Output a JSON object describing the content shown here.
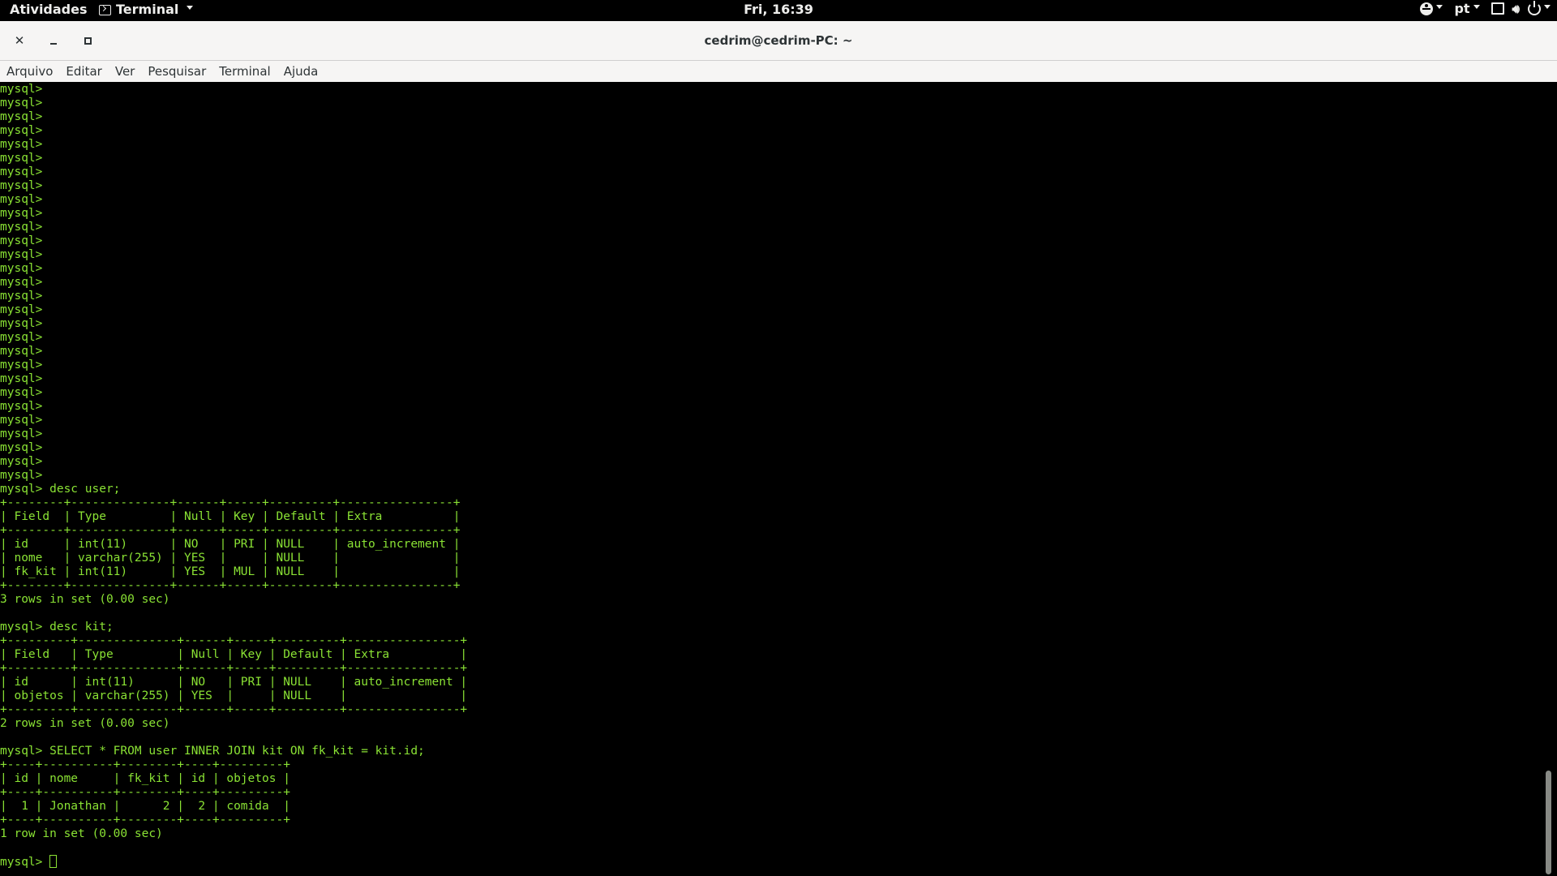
{
  "topbar": {
    "activities": "Atividades",
    "app_menu": "Terminal",
    "clock": "Fri, 16:39",
    "language": "pt"
  },
  "window": {
    "title": "cedrim@cedrim-PC: ~"
  },
  "menu": {
    "items": [
      "Arquivo",
      "Editar",
      "Ver",
      "Pesquisar",
      "Terminal",
      "Ajuda"
    ]
  },
  "terminal": {
    "text_color": "#8ae234",
    "lines": [
      "mysql>",
      "mysql>",
      "mysql>",
      "mysql>",
      "mysql>",
      "mysql>",
      "mysql>",
      "mysql>",
      "mysql>",
      "mysql>",
      "mysql>",
      "mysql>",
      "mysql>",
      "mysql>",
      "mysql>",
      "mysql>",
      "mysql>",
      "mysql>",
      "mysql>",
      "mysql>",
      "mysql>",
      "mysql>",
      "mysql>",
      "mysql>",
      "mysql>",
      "mysql>",
      "mysql>",
      "mysql>",
      "mysql>",
      "mysql> desc user;",
      "+--------+--------------+------+-----+---------+----------------+",
      "| Field  | Type         | Null | Key | Default | Extra          |",
      "+--------+--------------+------+-----+---------+----------------+",
      "| id     | int(11)      | NO   | PRI | NULL    | auto_increment |",
      "| nome   | varchar(255) | YES  |     | NULL    |                |",
      "| fk_kit | int(11)      | YES  | MUL | NULL    |                |",
      "+--------+--------------+------+-----+---------+----------------+",
      "3 rows in set (0.00 sec)",
      "",
      "mysql> desc kit;",
      "+---------+--------------+------+-----+---------+----------------+",
      "| Field   | Type         | Null | Key | Default | Extra          |",
      "+---------+--------------+------+-----+---------+----------------+",
      "| id      | int(11)      | NO   | PRI | NULL    | auto_increment |",
      "| objetos | varchar(255) | YES  |     | NULL    |                |",
      "+---------+--------------+------+-----+---------+----------------+",
      "2 rows in set (0.00 sec)",
      "",
      "mysql> SELECT * FROM user INNER JOIN kit ON fk_kit = kit.id;",
      "+----+----------+--------+----+---------+",
      "| id | nome     | fk_kit | id | objetos |",
      "+----+----------+--------+----+---------+",
      "|  1 | Jonathan |      2 |  2 | comida  |",
      "+----+----------+--------+----+---------+",
      "1 row in set (0.00 sec)",
      ""
    ],
    "prompt": "mysql> "
  }
}
